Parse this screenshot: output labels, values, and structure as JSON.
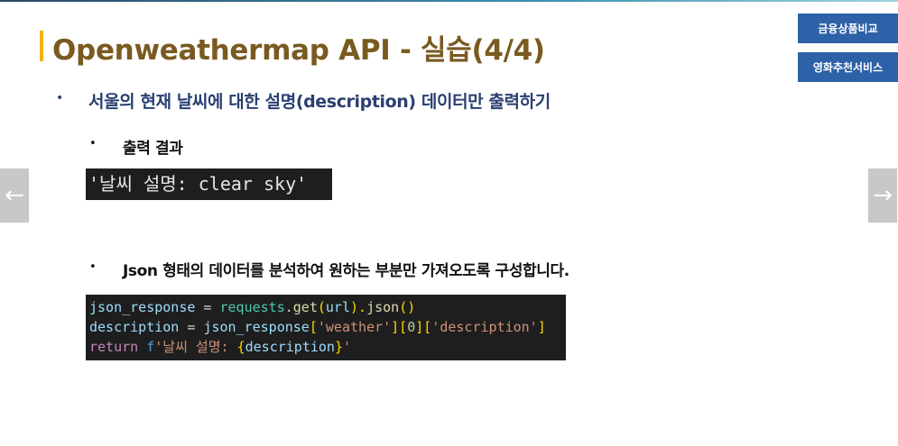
{
  "slide": {
    "title": "Openweathermap API - 실습(4/4)",
    "bullet_main": "서울의 현재 날씨에 대한 설명(description) 데이터만 출력하기",
    "sub1": "출력 결과",
    "output": "'날씨 설명: clear sky'",
    "sub2": "Json 형태의 데이터를 분석하여 원하는 부분만 가져오도록 구성합니다.",
    "bullet_glyph": "•"
  },
  "side_nav": {
    "btn1": "금융상품비교",
    "btn2": "영화추천서비스"
  },
  "nav": {
    "prev": "←",
    "next": "→"
  },
  "code": {
    "l1": {
      "a": "json_response",
      "b": " = ",
      "c": "requests",
      "d": ".",
      "e": "get",
      "f": "(",
      "g": "url",
      "h": ").",
      "i": "json",
      "j": "()"
    },
    "l2": {
      "a": "description",
      "b": " = ",
      "c": "json_response",
      "d": "[",
      "e": "'weather'",
      "f": "][",
      "g": "0",
      "h": "][",
      "i": "'description'",
      "j": "]"
    },
    "l3": {
      "a": "return",
      "b": " ",
      "c": "f",
      "d": "'날씨 설명: ",
      "e": "{",
      "f": "description",
      "g": "}",
      "h": "'"
    }
  },
  "colors": {
    "var": "#9cdcfe",
    "op": "#d4d4d4",
    "func": "#dcdcaa",
    "str": "#ce9178",
    "num": "#b5cea8",
    "kw": "#c586c0",
    "fprefix": "#569cd6",
    "brace": "#ffd700",
    "paren": "#ffd700"
  }
}
